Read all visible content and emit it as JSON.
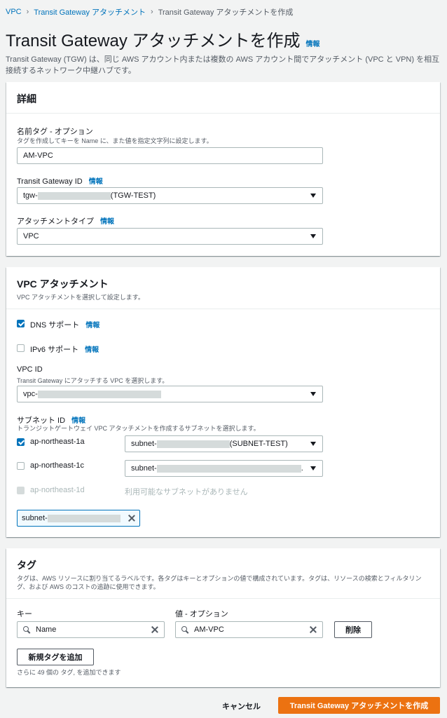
{
  "breadcrumb": {
    "items": [
      "VPC",
      "Transit Gateway アタッチメント"
    ],
    "current": "Transit Gateway アタッチメントを作成"
  },
  "header": {
    "title": "Transit Gateway アタッチメントを作成",
    "info": "情報",
    "description": "Transit Gateway (TGW) は、同じ AWS アカウント内または複数の AWS アカウント間でアタッチメント (VPC と VPN) を相互接続するネットワーク中継ハブです。"
  },
  "details": {
    "heading": "詳細",
    "name_tag_label": "名前タグ - オプション",
    "name_tag_desc": "タグを作成してキーを Name に、また値を指定文字列に設定します。",
    "name_tag_value": "AM-VPC",
    "tgw_id_label": "Transit Gateway ID",
    "tgw_id_info": "情報",
    "tgw_id_prefix": "tgw-",
    "tgw_id_suffix": "(TGW-TEST)",
    "attach_type_label": "アタッチメントタイプ",
    "attach_type_info": "情報",
    "attach_type_value": "VPC"
  },
  "vpc_attachment": {
    "heading": "VPC アタッチメント",
    "desc": "VPC アタッチメントを選択して設定します。",
    "dns_label": "DNS サポート",
    "dns_info": "情報",
    "dns_checked": true,
    "ipv6_label": "IPv6 サポート",
    "ipv6_info": "情報",
    "ipv6_checked": false,
    "vpc_id_label": "VPC ID",
    "vpc_id_desc": "Transit Gateway にアタッチする VPC を選択します。",
    "vpc_id_prefix": "vpc-",
    "subnet_label": "サブネット ID",
    "subnet_info": "情報",
    "subnet_desc": "トランジットゲートウェイ VPC アタッチメントを作成するサブネットを選択します。",
    "subnets": [
      {
        "az": "ap-northeast-1a",
        "checked": true,
        "prefix": "subnet-",
        "suffix": "(SUBNET-TEST)"
      },
      {
        "az": "ap-northeast-1c",
        "checked": false,
        "prefix": "subnet-",
        "suffix": "."
      },
      {
        "az": "ap-northeast-1d",
        "checked": false,
        "disabled": true,
        "note": "利用可能なサブネットがありません"
      }
    ],
    "token_prefix": "subnet-"
  },
  "tags": {
    "heading": "タグ",
    "desc": "タグは、AWS リソースに割り当てるラベルです。各タグはキーとオプションの値で構成されています。タグは、リソースの検索とフィルタリング、および AWS のコストの追跡に使用できます。",
    "key_label": "キー",
    "value_label": "値 - オプション",
    "key_value": "Name",
    "value_value": "AM-VPC",
    "remove_label": "削除",
    "add_label": "新規タグを追加",
    "remaining": "さらに 49 個の タグ, を追加できます"
  },
  "footer": {
    "cancel_label": "キャンセル",
    "create_label": "Transit Gateway アタッチメントを作成"
  },
  "colors": {
    "link": "#0073bb",
    "primary": "#ec7211",
    "background": "#f2f3f3"
  }
}
